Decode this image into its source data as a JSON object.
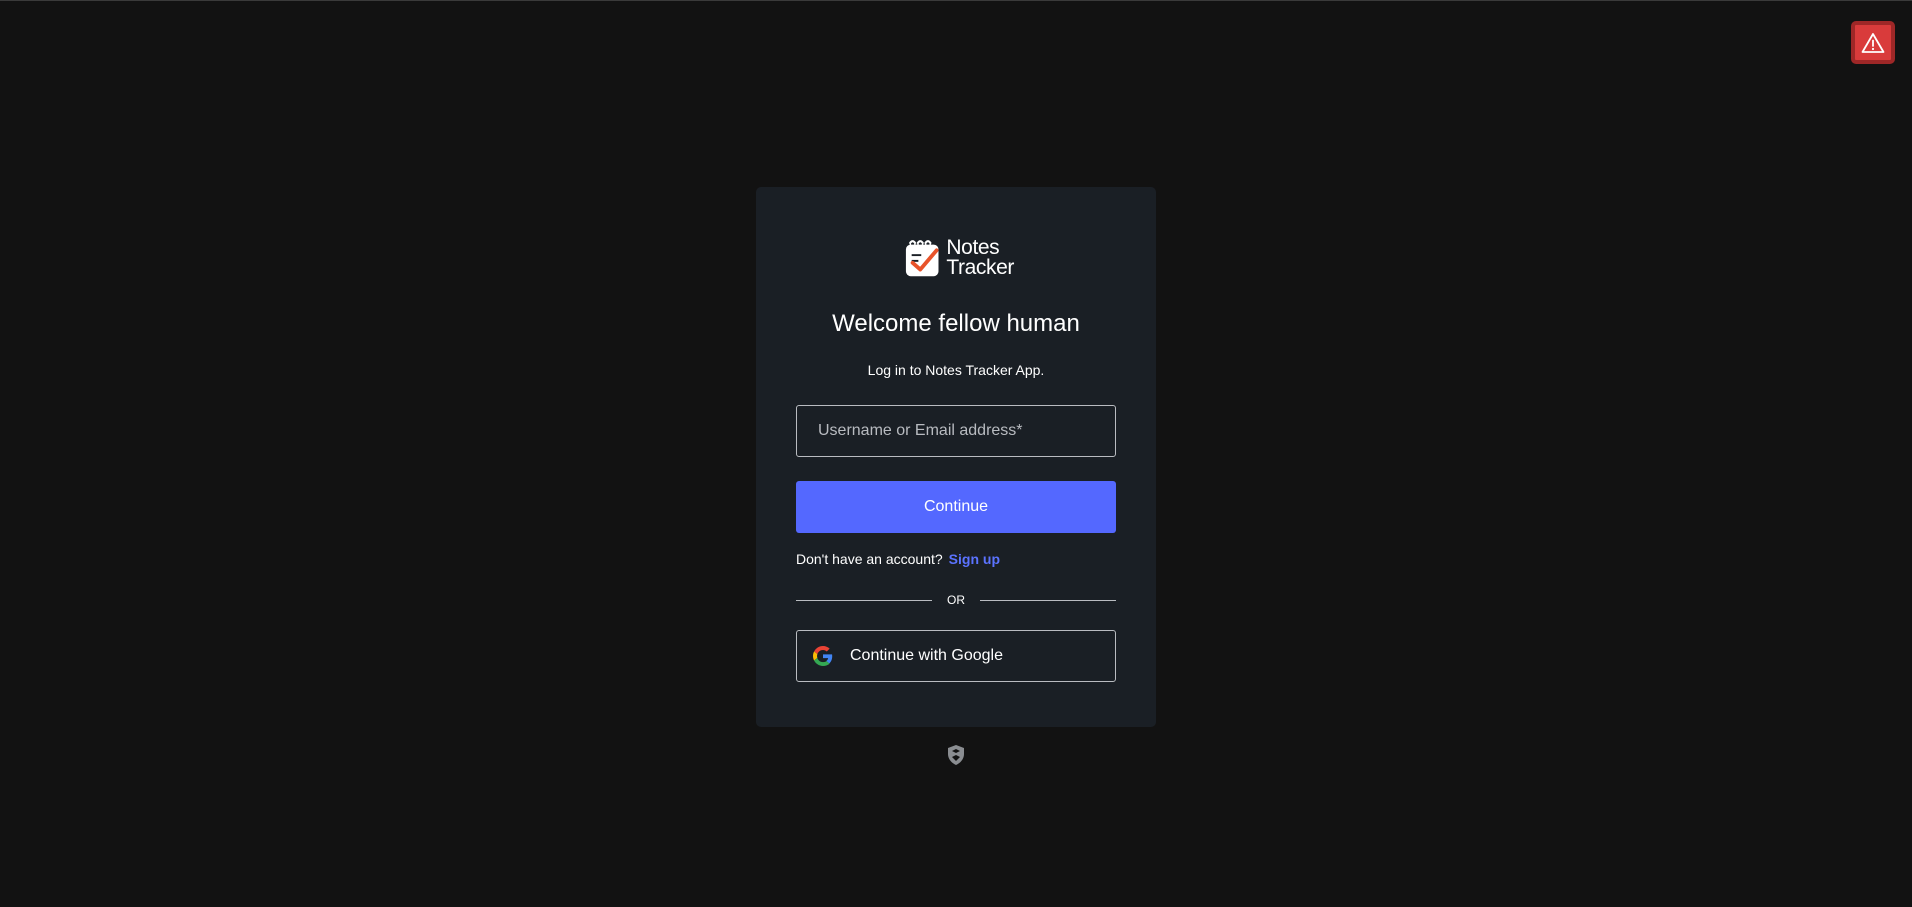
{
  "app": {
    "logo_line1": "Notes",
    "logo_line2": "Tracker"
  },
  "login": {
    "title": "Welcome fellow human",
    "subtitle": "Log in to Notes Tracker App.",
    "username_placeholder": "Username or Email address*",
    "username_value": "",
    "continue_label": "Continue",
    "no_account_text": "Don't have an account?",
    "signup_label": "Sign up",
    "divider_text": "OR",
    "google_label": "Continue with Google"
  },
  "icons": {
    "warning": "warning-icon",
    "google": "google-icon",
    "shield": "shield-icon",
    "logo": "notes-tracker-logo-icon"
  },
  "colors": {
    "background": "#121212",
    "card": "#1a1f25",
    "primary": "#5468ff",
    "link": "#5b73ff",
    "warning": "#d93b3b"
  }
}
